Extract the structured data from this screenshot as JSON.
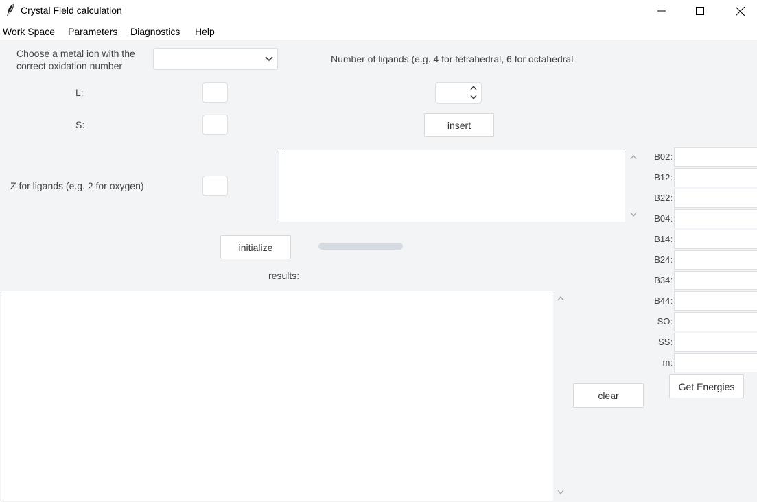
{
  "window": {
    "title": "Crystal Field calculation",
    "minimize_glyph": "—",
    "maximize_glyph": "☐",
    "close_glyph": "✕"
  },
  "menu": [
    "Work Space",
    "Parameters",
    "Diagnostics",
    "Help"
  ],
  "form": {
    "metal_label_line1": "Choose a metal ion with the",
    "metal_label_line2": "correct oxidation number",
    "metal_value": "",
    "ligands_count_label": "Number of ligands (e.g. 4 for tetrahedral, 6 for octahedral",
    "ligands_count_value": "",
    "l_label": "L:",
    "l_value": "",
    "s_label": "S:",
    "s_value": "",
    "insert_label": "insert",
    "z_label": "Z for ligands (e.g. 2 for oxygen)",
    "z_value": "",
    "ligand_text": "",
    "initialize_label": "initialize",
    "progress": 0,
    "results_label": "results:",
    "results_text": "",
    "clear_label": "clear"
  },
  "params": [
    {
      "label": "B02:",
      "value": ""
    },
    {
      "label": "B12:",
      "value": ""
    },
    {
      "label": "B22:",
      "value": ""
    },
    {
      "label": "B04:",
      "value": ""
    },
    {
      "label": "B14:",
      "value": ""
    },
    {
      "label": "B24:",
      "value": ""
    },
    {
      "label": "B34:",
      "value": ""
    },
    {
      "label": "B44:",
      "value": ""
    },
    {
      "label": "SO:",
      "value": ""
    },
    {
      "label": "SS:",
      "value": ""
    },
    {
      "label": "m:",
      "value": ""
    }
  ],
  "get_energies_label": "Get Energies",
  "colors": {
    "background": "#f3f4f6",
    "titlebar": "#ffffff",
    "progress_track": "#d6dbe1"
  }
}
